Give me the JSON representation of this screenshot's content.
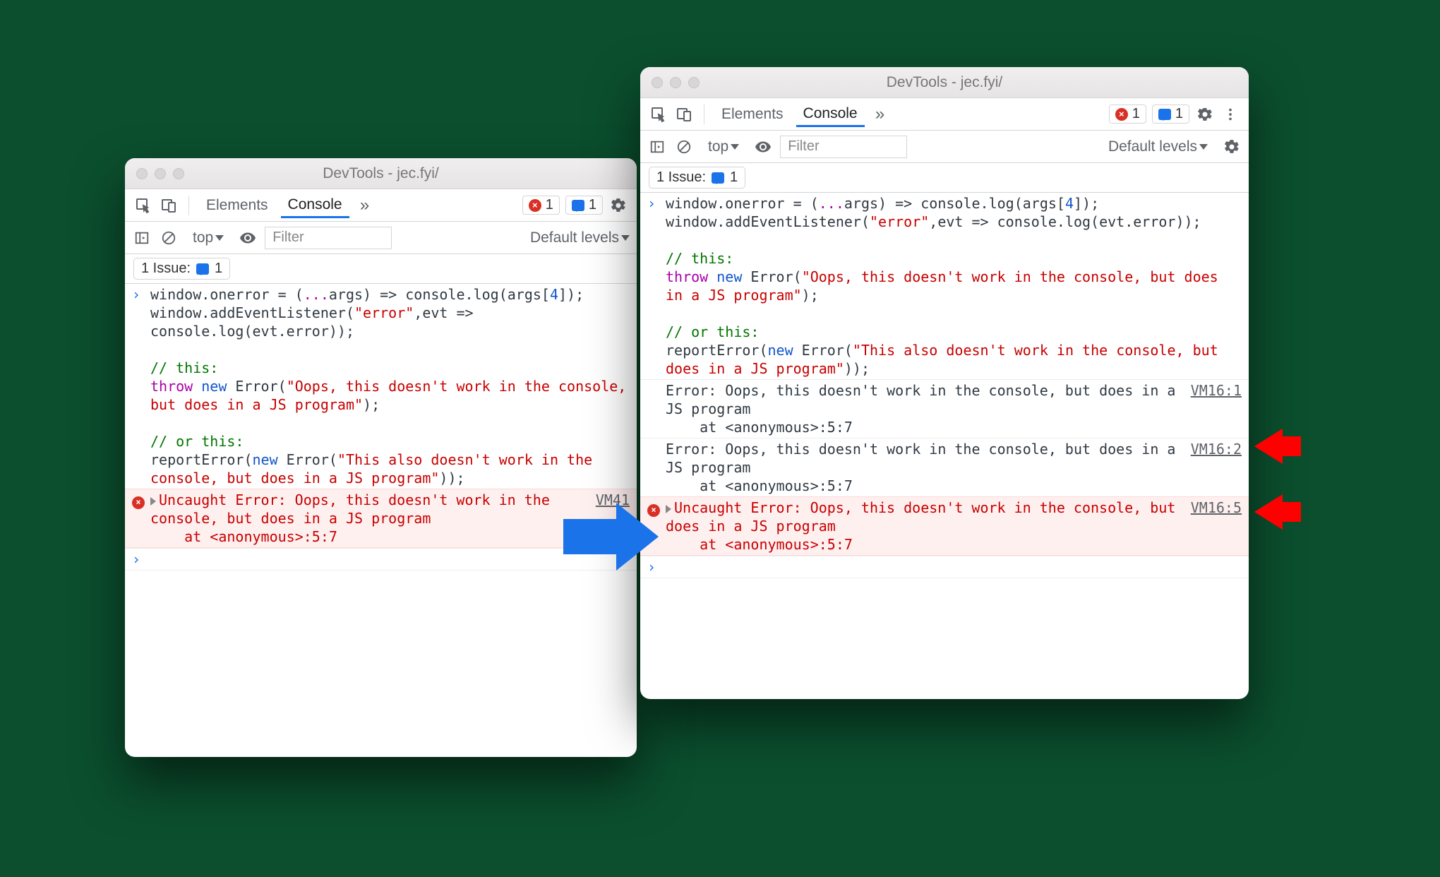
{
  "left": {
    "title": "DevTools - jec.fyi/",
    "tabs": {
      "elements": "Elements",
      "console": "Console"
    },
    "badges": {
      "error_count": "1",
      "msg_count": "1"
    },
    "subbar": {
      "context": "top",
      "filter_placeholder": "Filter",
      "levels": "Default levels"
    },
    "issue": {
      "label": "1 Issue:",
      "count": "1"
    },
    "code_segments": [
      {
        "t": "window.onerror = (",
        "c": ""
      },
      {
        "t": "...",
        "c": "c-pur"
      },
      {
        "t": "args) => console.log(args[",
        "c": ""
      },
      {
        "t": "4",
        "c": "c-num"
      },
      {
        "t": "]);\nwindow.addEventListener(",
        "c": ""
      },
      {
        "t": "\"error\"",
        "c": "c-red"
      },
      {
        "t": ",evt => console.log(evt.error));\n\n",
        "c": ""
      },
      {
        "t": "// this:",
        "c": "c-grn"
      },
      {
        "t": "\n",
        "c": ""
      },
      {
        "t": "throw",
        "c": "c-pur"
      },
      {
        "t": " ",
        "c": ""
      },
      {
        "t": "new",
        "c": "c-blu"
      },
      {
        "t": " Error(",
        "c": ""
      },
      {
        "t": "\"Oops, this doesn't work in the console, but does in a JS program\"",
        "c": "c-red"
      },
      {
        "t": ");\n\n",
        "c": ""
      },
      {
        "t": "// or this:",
        "c": "c-grn"
      },
      {
        "t": "\nreportError(",
        "c": ""
      },
      {
        "t": "new",
        "c": "c-blu"
      },
      {
        "t": " Error(",
        "c": ""
      },
      {
        "t": "\"This also doesn't work in the console, but does in a JS program\"",
        "c": "c-red"
      },
      {
        "t": "));",
        "c": ""
      }
    ],
    "error": {
      "text": "Uncaught Error: Oops, this doesn't work in the console, but does in a JS program\n    at <anonymous>:5:7",
      "src": "VM41"
    }
  },
  "right": {
    "title": "DevTools - jec.fyi/",
    "tabs": {
      "elements": "Elements",
      "console": "Console"
    },
    "badges": {
      "error_count": "1",
      "msg_count": "1"
    },
    "subbar": {
      "context": "top",
      "filter_placeholder": "Filter",
      "levels": "Default levels"
    },
    "issue": {
      "label": "1 Issue:",
      "count": "1"
    },
    "code_segments": [
      {
        "t": "window.onerror = (",
        "c": ""
      },
      {
        "t": "...",
        "c": "c-pur"
      },
      {
        "t": "args) => console.log(args[",
        "c": ""
      },
      {
        "t": "4",
        "c": "c-num"
      },
      {
        "t": "]);\nwindow.addEventListener(",
        "c": ""
      },
      {
        "t": "\"error\"",
        "c": "c-red"
      },
      {
        "t": ",evt => console.log(evt.error));\n\n",
        "c": ""
      },
      {
        "t": "// this:",
        "c": "c-grn"
      },
      {
        "t": "\n",
        "c": ""
      },
      {
        "t": "throw",
        "c": "c-pur"
      },
      {
        "t": " ",
        "c": ""
      },
      {
        "t": "new",
        "c": "c-blu"
      },
      {
        "t": " Error(",
        "c": ""
      },
      {
        "t": "\"Oops, this doesn't work in the console, but does in a JS program\"",
        "c": "c-red"
      },
      {
        "t": ");\n\n",
        "c": ""
      },
      {
        "t": "// or this:",
        "c": "c-grn"
      },
      {
        "t": "\nreportError(",
        "c": ""
      },
      {
        "t": "new",
        "c": "c-blu"
      },
      {
        "t": " Error(",
        "c": ""
      },
      {
        "t": "\"This also doesn't work in the console, but does in a JS program\"",
        "c": "c-red"
      },
      {
        "t": "));",
        "c": ""
      }
    ],
    "log1": {
      "text": "Error: Oops, this doesn't work in the console, but does in a JS program\n    at <anonymous>:5:7",
      "src": "VM16:1"
    },
    "log2": {
      "text": "Error: Oops, this doesn't work in the console, but does in a JS program\n    at <anonymous>:5:7",
      "src": "VM16:2"
    },
    "error": {
      "text": "Uncaught Error: Oops, this doesn't work in the console, but does in a JS program\n    at <anonymous>:5:7",
      "src": "VM16:5"
    }
  }
}
